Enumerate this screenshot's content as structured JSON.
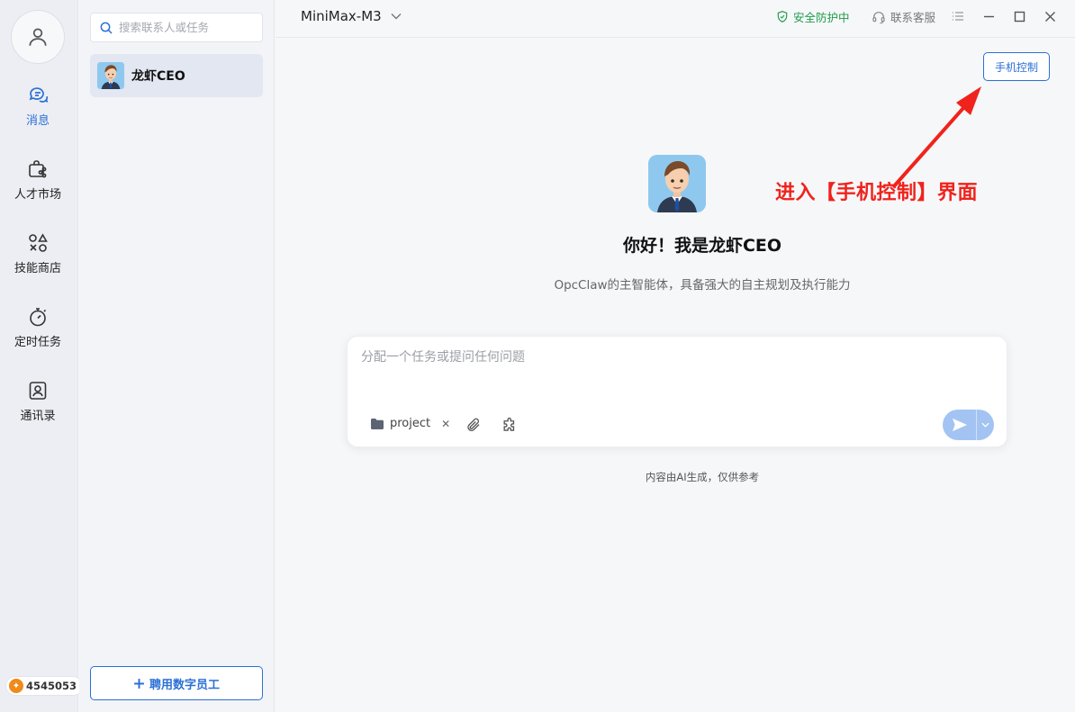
{
  "nav": {
    "items": [
      {
        "label": "消息",
        "icon": "chat-bubbles-icon",
        "active": true
      },
      {
        "label": "人才市场",
        "icon": "briefcase-share-icon",
        "active": false
      },
      {
        "label": "技能商店",
        "icon": "shapes-icon",
        "active": false
      },
      {
        "label": "定时任务",
        "icon": "stopwatch-icon",
        "active": false
      },
      {
        "label": "通讯录",
        "icon": "contact-card-icon",
        "active": false
      }
    ],
    "coins": "4545053"
  },
  "contacts": {
    "search_placeholder": "搜索联系人或任务",
    "list": [
      {
        "name": "龙虾CEO"
      }
    ],
    "hire_label": "聘用数字员工"
  },
  "topbar": {
    "model": "MiniMax-M3",
    "security": "安全防护中",
    "support": "联系客服"
  },
  "main": {
    "phone_control": "手机控制",
    "annotation": "进入【手机控制】界面",
    "greeting": "你好！我是龙虾CEO",
    "subtitle": "OpcClaw的主智能体，具备强大的自主规划及执行能力",
    "input_placeholder": "分配一个任务或提问任何问题",
    "chip_label": "project",
    "disclaimer": "内容由AI生成，仅供参考"
  },
  "colors": {
    "accent": "#2b6fd6",
    "security_green": "#1f9c4a",
    "annotation_red": "#f0231c",
    "send_disabled": "#a3c4f3",
    "coin_orange": "#f08a19"
  }
}
